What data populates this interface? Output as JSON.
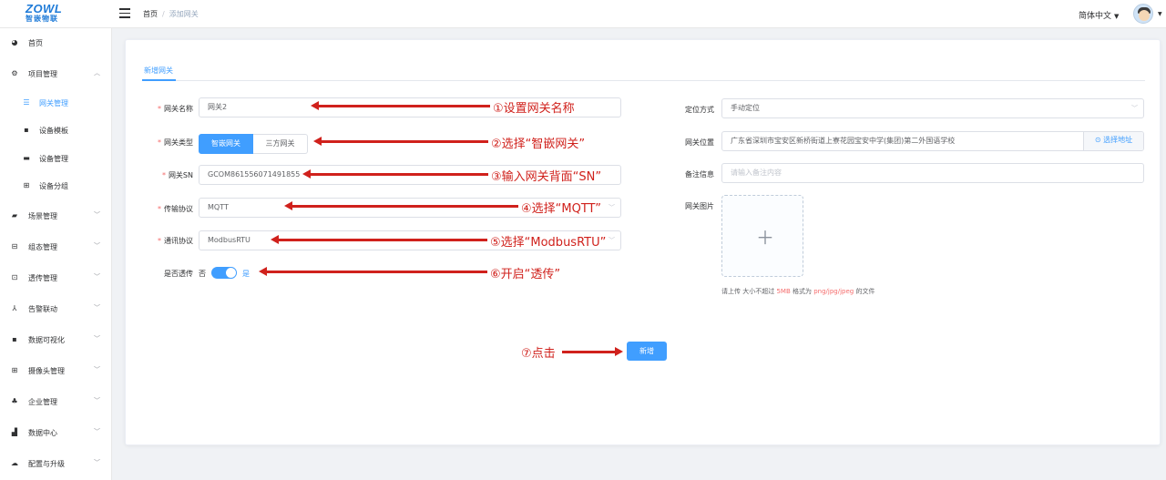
{
  "header": {
    "logo_brand": "ZOWL",
    "logo_sub": "智嵌物联",
    "breadcrumb": [
      "首页",
      "添加网关"
    ],
    "language": "简体中文"
  },
  "sidebar": {
    "items": [
      {
        "label": "首页",
        "icon": "dashboard-icon"
      },
      {
        "label": "项目管理",
        "icon": "project-icon"
      },
      {
        "label": "网关管理",
        "icon": "gateway-icon"
      },
      {
        "label": "设备模板",
        "icon": "grid-icon"
      },
      {
        "label": "设备管理",
        "icon": "device-icon"
      },
      {
        "label": "设备分组",
        "icon": "group-icon"
      },
      {
        "label": "场景管理",
        "icon": "scene-icon"
      },
      {
        "label": "组态管理",
        "icon": "config-icon"
      },
      {
        "label": "透传管理",
        "icon": "passthrough-icon"
      },
      {
        "label": "告警联动",
        "icon": "alarm-icon"
      },
      {
        "label": "数据可视化",
        "icon": "visual-icon"
      },
      {
        "label": "摄像头管理",
        "icon": "camera-icon"
      },
      {
        "label": "企业管理",
        "icon": "enterprise-icon"
      },
      {
        "label": "数据中心",
        "icon": "data-center-icon"
      },
      {
        "label": "配置与升级",
        "icon": "upgrade-icon"
      }
    ]
  },
  "form": {
    "tab": "新增网关",
    "name_label": "网关名称",
    "name_value": "网关2",
    "type_label": "网关类型",
    "type_options": [
      "智嵌网关",
      "三方网关"
    ],
    "sn_label": "网关SN",
    "sn_value": "GCOM861556071491855",
    "transport_label": "传输协议",
    "transport_value": "MQTT",
    "comm_label": "通讯协议",
    "comm_value": "ModbusRTU",
    "passthrough_label": "是否透传",
    "passthrough_no": "否",
    "passthrough_yes": "是",
    "locate_label": "定位方式",
    "locate_value": "手动定位",
    "location_label": "网关位置",
    "location_value": "广东省深圳市宝安区新桥街道上寮花园宝安中学(集团)第二外国语学校",
    "pick_address": "选择地址",
    "remark_label": "备注信息",
    "remark_placeholder": "请输入备注内容",
    "image_label": "网关图片",
    "upload_hint_pre": "请上传 大小不超过 ",
    "upload_hint_size": "5MB",
    "upload_hint_mid": " 格式为 ",
    "upload_hint_fmt": "png/jpg/jpeg",
    "upload_hint_post": " 的文件",
    "submit": "新增"
  },
  "annotations": {
    "a1": "①设置网关名称",
    "a2": "②选择“智嵌网关”",
    "a3": "③输入网关背面“SN”",
    "a4": "④选择“MQTT”",
    "a5": "⑤选择“ModbusRTU”",
    "a6": "⑥开启“透传”",
    "a7": "⑦点击"
  },
  "colors": {
    "primary": "#409eff",
    "annotation": "#d0211c",
    "required": "#f56c6c"
  }
}
